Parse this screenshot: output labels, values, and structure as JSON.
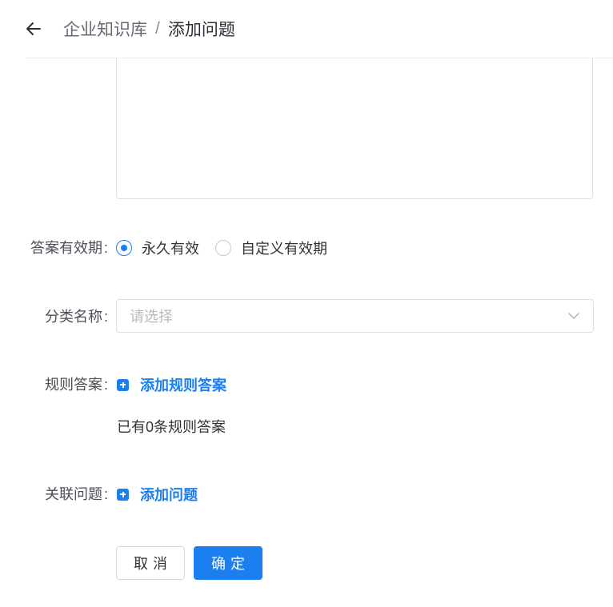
{
  "header": {
    "breadcrumb_root": "企业知识库",
    "breadcrumb_separator": "/",
    "breadcrumb_current": "添加问题"
  },
  "form": {
    "validity": {
      "label": "答案有效期",
      "options": [
        {
          "label": "永久有效",
          "checked": true
        },
        {
          "label": "自定义有效期",
          "checked": false
        }
      ]
    },
    "category": {
      "label": "分类名称",
      "placeholder": "请选择"
    },
    "rule_answer": {
      "label": "规则答案",
      "add_label": "添加规则答案",
      "count_text": "已有0条规则答案"
    },
    "related_question": {
      "label": "关联问题",
      "add_label": "添加问题"
    },
    "colon": ":"
  },
  "actions": {
    "cancel_label": "取消",
    "confirm_label": "确定"
  },
  "colors": {
    "primary": "#1b7ff0",
    "border": "#dcdfe6",
    "placeholder": "#b7bac0"
  }
}
